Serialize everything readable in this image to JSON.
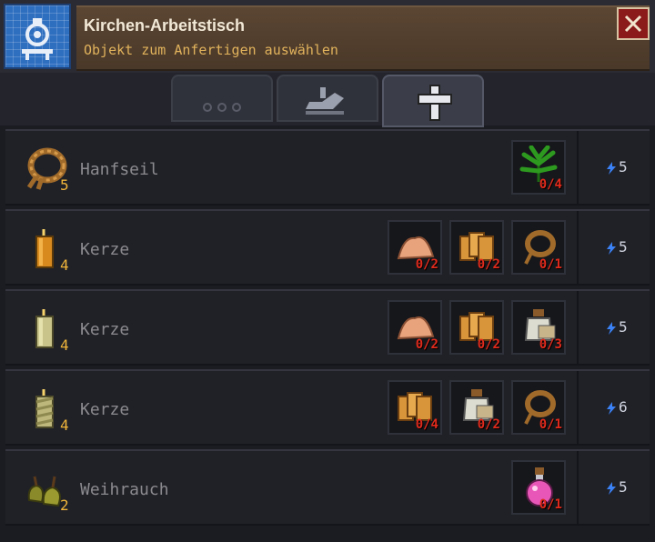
{
  "header": {
    "title": "Kirchen-Arbeitstisch",
    "subtitle": "Objekt zum Anfertigen auswählen",
    "close_icon": "close-x-icon"
  },
  "tabs": [
    {
      "icon": "ellipsis-icon",
      "active": false
    },
    {
      "icon": "plane-tool-icon",
      "active": false
    },
    {
      "icon": "cross-icon",
      "active": true
    }
  ],
  "recipes": [
    {
      "name": "Hanfseil",
      "count": "5",
      "icon": "rope-icon",
      "energy": "5",
      "ingredients": [
        {
          "icon": "hemp-plant-icon",
          "amount": "0/4",
          "color": "#2d9a1f"
        }
      ]
    },
    {
      "name": "Kerze",
      "count": "4",
      "icon": "orange-candle-icon",
      "energy": "5",
      "ingredients": [
        {
          "icon": "tallow-icon",
          "amount": "0/2",
          "color": "#e8a37c"
        },
        {
          "icon": "wax-block-icon",
          "amount": "0/2",
          "color": "#d9953a"
        },
        {
          "icon": "rope-icon",
          "amount": "0/1",
          "color": "#a06a2a"
        }
      ]
    },
    {
      "name": "Kerze",
      "count": "4",
      "icon": "white-candle-icon",
      "energy": "5",
      "ingredients": [
        {
          "icon": "tallow-icon",
          "amount": "0/2",
          "color": "#e8a37c"
        },
        {
          "icon": "wax-block-icon",
          "amount": "0/2",
          "color": "#d9953a"
        },
        {
          "icon": "jar-icon",
          "amount": "0/3",
          "color": "#dcdcd0"
        }
      ]
    },
    {
      "name": "Kerze",
      "count": "4",
      "icon": "twisted-candle-icon",
      "energy": "6",
      "ingredients": [
        {
          "icon": "wax-block-icon",
          "amount": "0/4",
          "color": "#d9953a"
        },
        {
          "icon": "jar-icon",
          "amount": "0/2",
          "color": "#dcdcd0"
        },
        {
          "icon": "rope-icon",
          "amount": "0/1",
          "color": "#a06a2a"
        }
      ]
    },
    {
      "name": "Weihrauch",
      "count": "2",
      "icon": "incense-icon",
      "energy": "5",
      "ingredients": [
        {
          "icon": "pink-potion-icon",
          "amount": "0/1",
          "color": "#e857b8"
        }
      ]
    }
  ],
  "colors": {
    "count": "#f0b53a",
    "missing_amount": "#e02a1c",
    "energy_bolt": "#3b82f6"
  }
}
